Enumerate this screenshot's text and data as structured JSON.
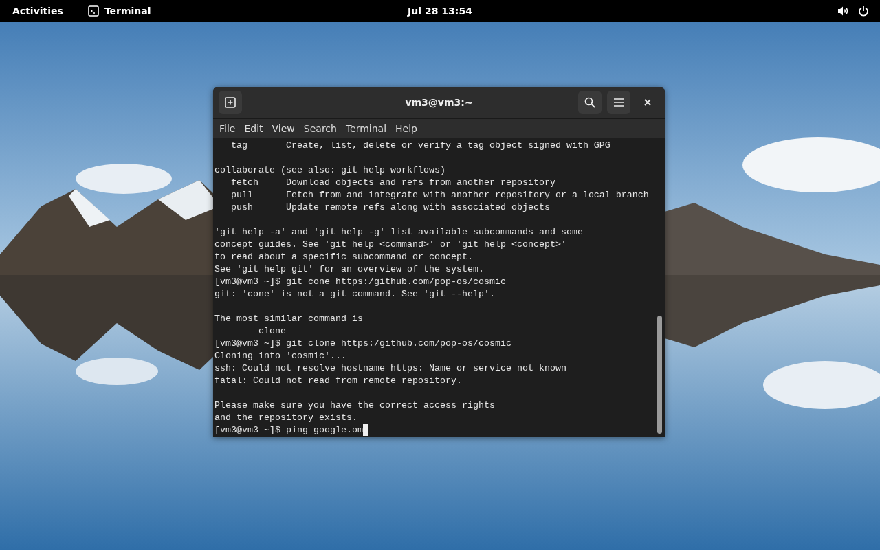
{
  "top_bar": {
    "activities": "Activities",
    "app_name": "Terminal",
    "clock": "Jul 28  13:54"
  },
  "window": {
    "title": "vm3@vm3:~",
    "menu": [
      "File",
      "Edit",
      "View",
      "Search",
      "Terminal",
      "Help"
    ],
    "terminal": {
      "blocks": [
        [
          "   tag       Create, list, delete or verify a tag object signed with GPG"
        ],
        [
          "collaborate (see also: git help workflows)",
          "   fetch     Download objects and refs from another repository",
          "   pull      Fetch from and integrate with another repository or a local branch",
          "   push      Update remote refs along with associated objects"
        ],
        [
          "'git help -a' and 'git help -g' list available subcommands and some",
          "concept guides. See 'git help <command>' or 'git help <concept>'",
          "to read about a specific subcommand or concept.",
          "See 'git help git' for an overview of the system.",
          "[vm3@vm3 ~]$ git cone https:/github.com/pop-os/cosmic",
          "git: 'cone' is not a git command. See 'git --help'."
        ],
        [
          "The most similar command is",
          "        clone",
          "[vm3@vm3 ~]$ git clone https:/github.com/pop-os/cosmic",
          "Cloning into 'cosmic'...",
          "ssh: Could not resolve hostname https: Name or service not known",
          "fatal: Could not read from remote repository."
        ],
        [
          "Please make sure you have the correct access rights",
          "and the repository exists.",
          "[vm3@vm3 ~]$ ping google.om"
        ]
      ],
      "cursor": true
    }
  }
}
